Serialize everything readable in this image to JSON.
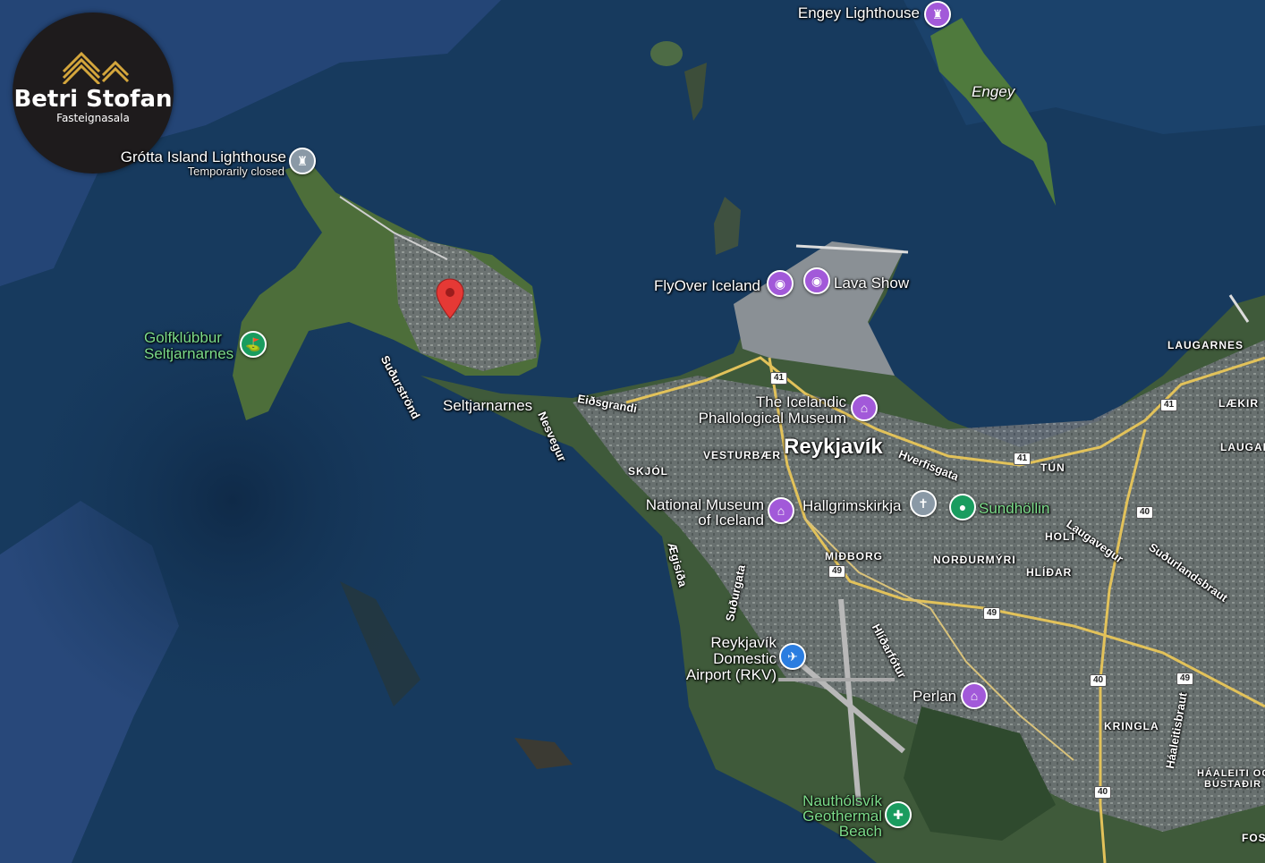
{
  "logo": {
    "title": "Betri Stofan",
    "subtitle": "Fasteignasala"
  },
  "pois": {
    "engey_lighthouse": "Engey Lighthouse",
    "grotta_lighthouse": "Grótta Island Lighthouse",
    "grotta_status": "Temporarily closed",
    "golf_line1": "Golfklúbbur",
    "golf_line2": "Seltjarnarnes",
    "flyover": "FlyOver Iceland",
    "lava_show": "Lava Show",
    "phallological_line1": "The Icelandic",
    "phallological_line2": "Phallological Museum",
    "national_museum_line1": "National Museum",
    "national_museum_line2": "of Iceland",
    "hallgrimskirkja": "Hallgrimskirkja",
    "sundhollin": "Sundhöllin",
    "airport_line1": "Reykjavík",
    "airport_line2": "Domestic",
    "airport_line3": "Airport (RKV)",
    "perlan": "Perlan",
    "nautholsvik_line1": "Nauthólsvík",
    "nautholsvik_line2": "Geothermal",
    "nautholsvik_line3": "Beach"
  },
  "places": {
    "engey": "Engey",
    "reykjavik": "Reykjavík",
    "seltjarnarnes": "Seltjarnarnes",
    "vesturbaer": "VESTURBÆR",
    "skjol": "SKJÓL",
    "midborg": "MIÐBORG",
    "nordurmyri": "NORÐURMÝRI",
    "hlidar": "HLÍÐAR",
    "holt": "HOLT",
    "tun": "TÚN",
    "laugarnes": "LAUGARNES",
    "laekir": "LÆKIR",
    "laugar": "LAUGAR",
    "kringla": "KRINGLA",
    "haaleiti_line1": "HÁALEITI OG",
    "haaleiti_line2": "BÚSTAÐIR",
    "foss": "FOS"
  },
  "streets": {
    "sudurstrond": "Suðurströnd",
    "eidsgrandi": "Eiðsgrandi",
    "nesvegur": "Nesvegur",
    "hverfisgata": "Hverfisgata",
    "laugavegur": "Laugavegur",
    "sudurlandsbraut": "Suðurlandsbraut",
    "aegisida": "Ægisíða",
    "sudurgata": "Suðurgata",
    "hlidarfotur": "Hlíðarfótur",
    "haaleitisbraut": "Háaleitisbraut"
  },
  "road_shields": {
    "r41_a": "41",
    "r41_b": "41",
    "r41_c": "41",
    "r40_a": "40",
    "r40_b": "40",
    "r40_c": "40",
    "r49_a": "49",
    "r49_b": "49",
    "r49_c": "49"
  },
  "icons": {
    "attraction": "camera-icon",
    "museum": "museum-icon",
    "church": "church-icon",
    "pool": "pool-icon",
    "airport": "airplane-icon",
    "golf": "golf-icon",
    "lighthouse": "lighthouse-icon",
    "hiking": "hiking-icon",
    "selected": "red-location-marker-icon"
  },
  "colors": {
    "water": "#173a5e",
    "land": "#3d5a3a",
    "urban": "#7d7d80",
    "road": "#e2c25a",
    "marker": "#e53935",
    "poi_purple": "#a259d9",
    "poi_green": "#1a9c5f",
    "logo_bg": "#1e1b1c",
    "logo_gold": "#d4a63c"
  }
}
